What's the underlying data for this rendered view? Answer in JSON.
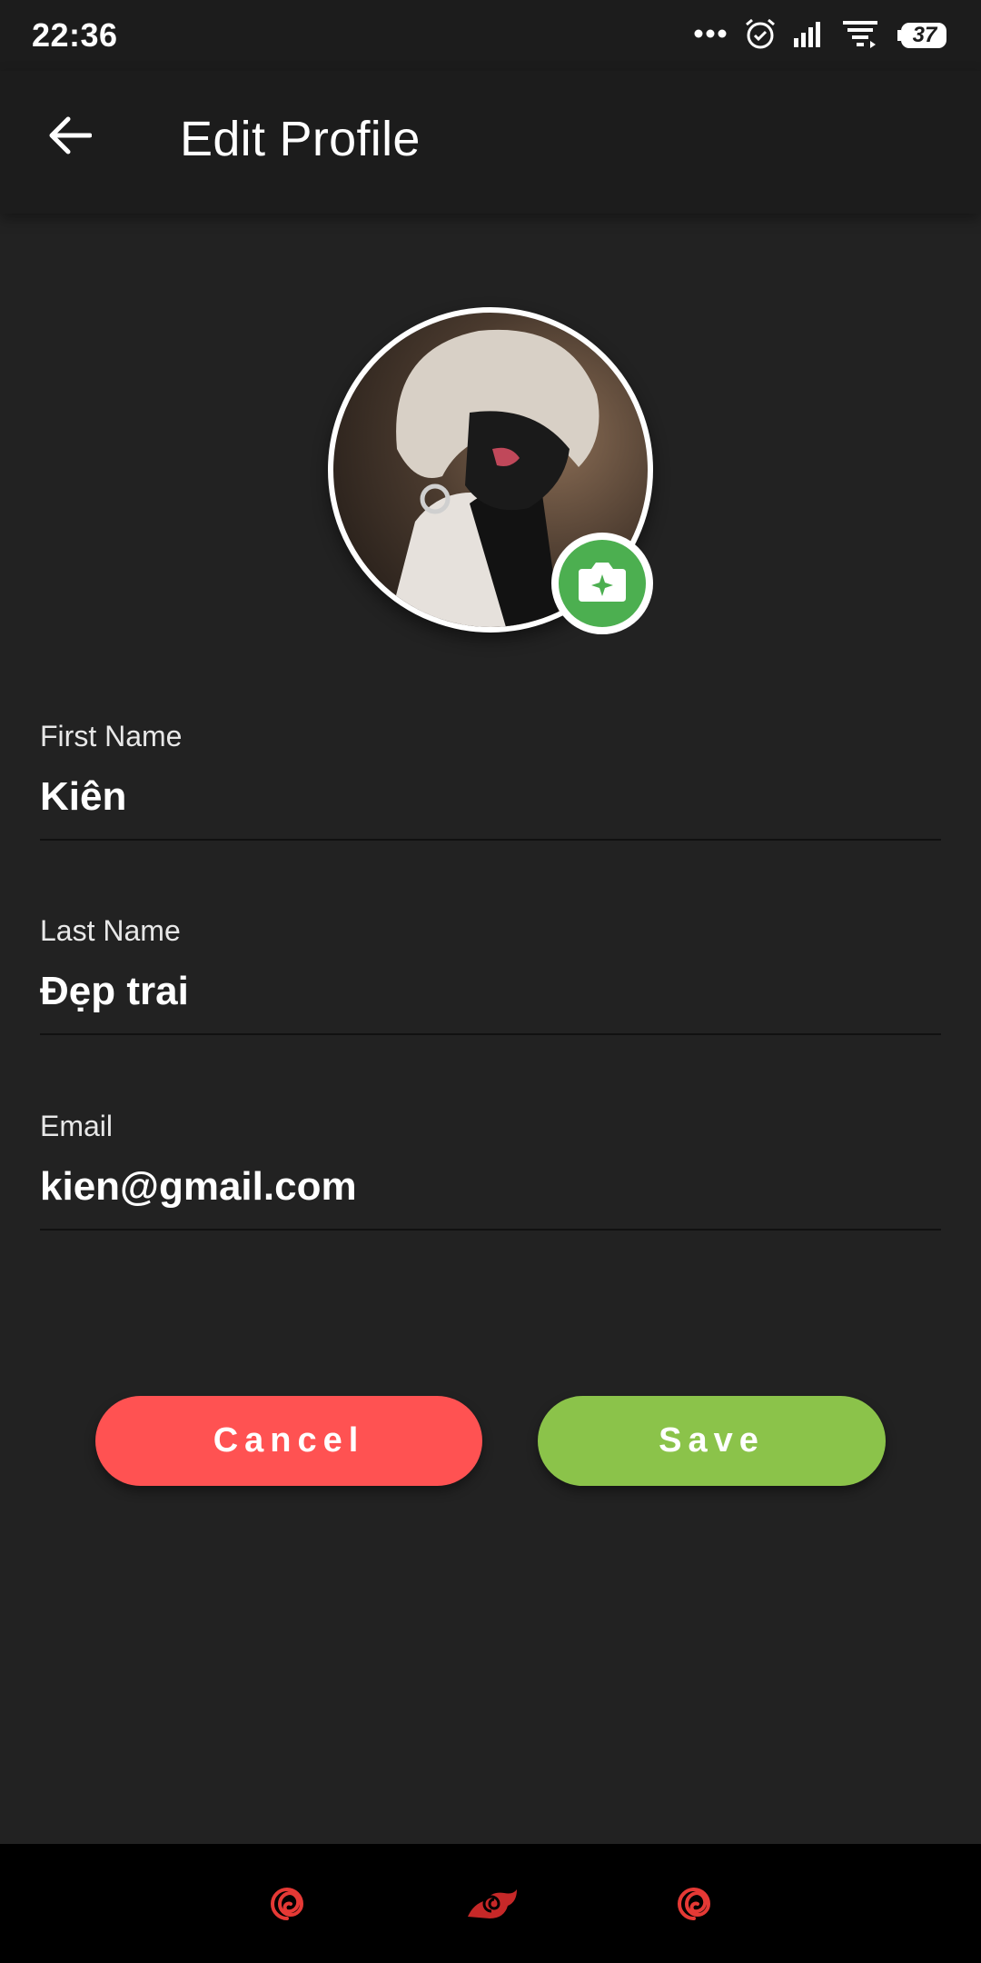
{
  "status_bar": {
    "time": "22:36",
    "battery_level": "37",
    "icons": [
      "more-dots-icon",
      "alarm-icon",
      "signal-icon",
      "wifi-icon",
      "battery-icon"
    ]
  },
  "app_bar": {
    "title": "Edit Profile",
    "back_icon": "arrow-back-icon"
  },
  "avatar": {
    "camera_icon": "camera-icon",
    "accent_color": "#4caf50"
  },
  "form": {
    "first_name": {
      "label": "First Name",
      "value": "Kiên"
    },
    "last_name": {
      "label": "Last Name",
      "value": "Đẹp trai"
    },
    "email": {
      "label": "Email",
      "value": "kien@gmail.com"
    }
  },
  "actions": {
    "cancel_label": "Cancel",
    "save_label": "Save",
    "cancel_color": "#ff5252",
    "save_color": "#8bc34a"
  },
  "nav_bar": {
    "icons": [
      "recents-swirl-icon",
      "home-cloud-icon",
      "back-swirl-icon"
    ],
    "icon_color": "#e53935"
  }
}
